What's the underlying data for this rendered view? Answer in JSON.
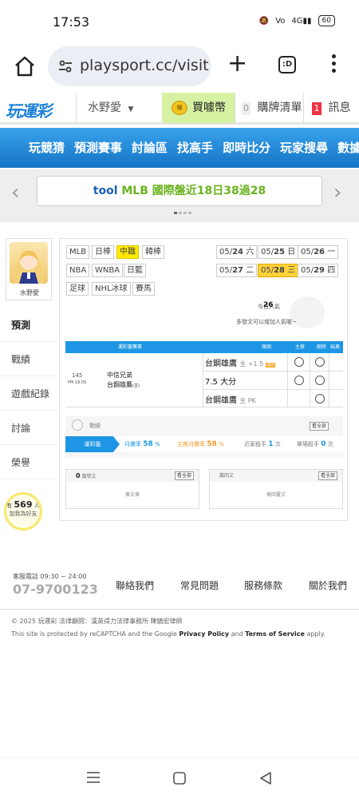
{
  "status_bar": {
    "time": "17:53",
    "signal": "4G",
    "battery": "60"
  },
  "browser": {
    "url": "playsport.cc/visit",
    "tabs_label": ":D"
  },
  "header": {
    "logo": "玩運彩",
    "username": "水野愛",
    "buy_label": "買噱幣",
    "coin_label": "噱",
    "cart_count": "0",
    "cart_label": "購牌清單",
    "msg_count": "1",
    "msg_label": "訊息"
  },
  "nav": {
    "items": [
      "玩競猜",
      "預測賽事",
      "討論區",
      "找高手",
      "即時比分",
      "玩家搜尋",
      "數據"
    ]
  },
  "banner": {
    "lead": "tool",
    "text": "MLB 國際盤近18日38過28"
  },
  "sidebar": {
    "name": "水野愛",
    "items": [
      "預測",
      "戰績",
      "遊戲紀錄",
      "討論",
      "榮譽"
    ],
    "bulb_prefix": "有",
    "bulb_count": "569",
    "bulb_unit": "人",
    "bulb_label": "加我為好友"
  },
  "leagues": {
    "row1": [
      "MLB",
      "日棒",
      "中職",
      "韓棒"
    ],
    "row2": [
      "NBA",
      "WNBA",
      "日籃"
    ],
    "row3": [
      "足球",
      "NHL冰球",
      "賽馬"
    ],
    "selected": "中職"
  },
  "dates": {
    "row1": [
      {
        "d": "05/",
        "n": "24",
        "w": "六"
      },
      {
        "d": "05/",
        "n": "25",
        "w": "日"
      },
      {
        "d": "05/",
        "n": "26",
        "w": "一"
      }
    ],
    "row2": [
      {
        "d": "05/",
        "n": "27",
        "w": "二"
      },
      {
        "d": "05/",
        "n": "28",
        "w": "三"
      },
      {
        "d": "05/",
        "n": "29",
        "w": "四"
      }
    ],
    "selected": "28"
  },
  "popularity": {
    "label": "今日人氣",
    "value": "26",
    "hint": "多發文可以增加人氣喔~"
  },
  "table": {
    "headers": {
      "game": "運彩盤賽事",
      "prediction": "預測",
      "main": "主推",
      "delete": "刪除",
      "result": "結果"
    },
    "game": {
      "number": "145",
      "time": "PM 18:05",
      "away": "中信兄弟",
      "home": "台鋼雄鷹",
      "home_suffix": "(主)"
    },
    "rows": [
      {
        "pick": "台鋼雄鷹",
        "note": "主 +1.5",
        "badge": "讓分"
      },
      {
        "pick": "7.5 大分",
        "note": "",
        "badge": ""
      },
      {
        "pick": "台鋼雄鷹",
        "note": "主 PK",
        "badge": ""
      }
    ]
  },
  "stats": {
    "title": "戰績",
    "see_all": "看全部",
    "tab": "運彩盤",
    "month_win_label": "月勝率",
    "month_win_value": "58",
    "main_month_label": "主推月勝率",
    "main_month_value": "58",
    "recent_label": "近家殺手",
    "recent_value": "1",
    "single_label": "單場殺手",
    "single_value": "0",
    "unit_pct": "%",
    "unit_times": "次"
  },
  "posts": {
    "left_count": "0",
    "left_title": "篇發文",
    "left_empty": "無文章",
    "right_title": "篇回文",
    "right_empty": "無回覆文",
    "see_all": "看全部"
  },
  "footer": {
    "service_label": "客服電話 09:30 ~ 24:00",
    "phone": "07-9700123",
    "links": [
      "聯絡我們",
      "常見問題",
      "服務條款",
      "關於我們"
    ],
    "copyright": "© 2025 玩運彩  法律顧問：漢英得力法律事務所 陳鎮宏律師",
    "recaptcha_pre": "This site is protected by reCAPTCHA and the Google ",
    "privacy": "Privacy Policy",
    "and": " and ",
    "terms": "Terms of Service",
    "apply": " apply."
  }
}
